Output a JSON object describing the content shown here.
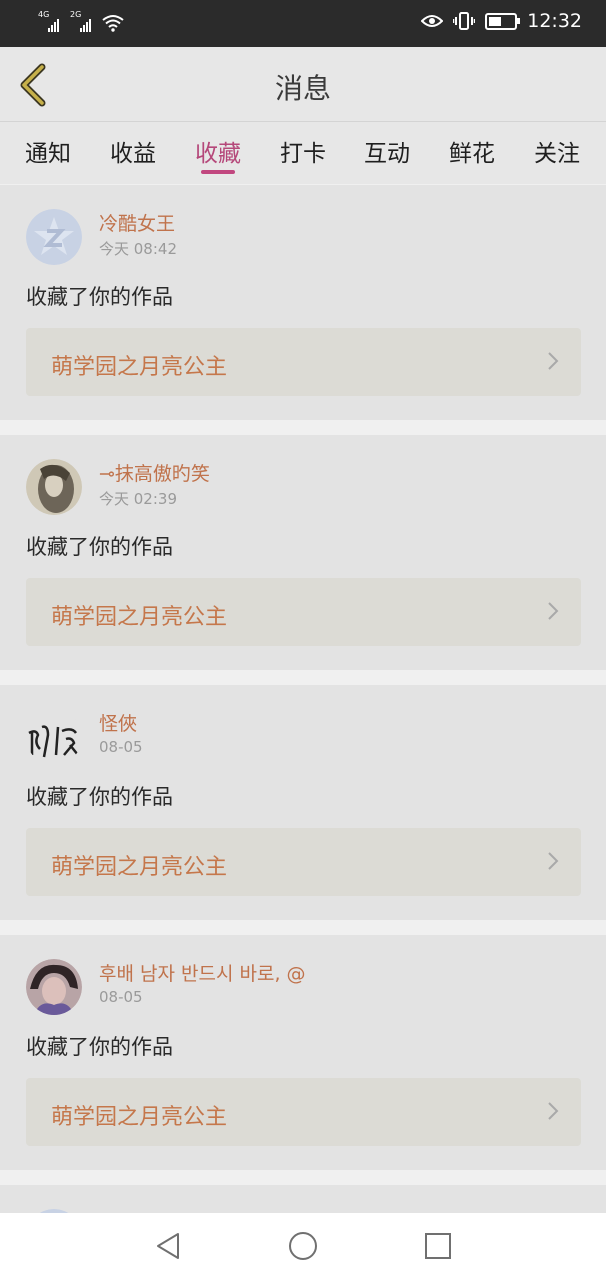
{
  "status_bar": {
    "signal1": "4G",
    "signal2": "2G",
    "time": "12:32",
    "icons": [
      "eye-icon",
      "vibrate-icon",
      "battery-icon",
      "wifi-icon"
    ]
  },
  "header": {
    "title": "消息",
    "back_icon": "chevron-left-icon"
  },
  "tabs": [
    {
      "label": "通知",
      "active": false
    },
    {
      "label": "收益",
      "active": false
    },
    {
      "label": "收藏",
      "active": true
    },
    {
      "label": "打卡",
      "active": false
    },
    {
      "label": "互动",
      "active": false
    },
    {
      "label": "鲜花",
      "active": false
    },
    {
      "label": "关注",
      "active": false
    }
  ],
  "items": [
    {
      "user": "冷酷女王",
      "time": "今天 08:42",
      "action": "收藏了你的作品",
      "work": "萌学园之月亮公主"
    },
    {
      "user": "⊸抹高傲旳笑",
      "time": "今天 02:39",
      "action": "收藏了你的作品",
      "work": "萌学园之月亮公主"
    },
    {
      "user": "怪俠",
      "time": "08-05",
      "action": "收藏了你的作品",
      "work": "萌学园之月亮公主"
    },
    {
      "user": "후배 남자 반드시 바로, @",
      "time": "08-05",
      "action": "收藏了你的作品",
      "work": "萌学园之月亮公主"
    }
  ],
  "colors": {
    "accent": "#c1477f",
    "username": "#c0734c",
    "work_title": "#c5774b"
  },
  "navbar": {
    "icons": [
      "back-triangle-icon",
      "home-circle-icon",
      "recents-square-icon"
    ]
  }
}
